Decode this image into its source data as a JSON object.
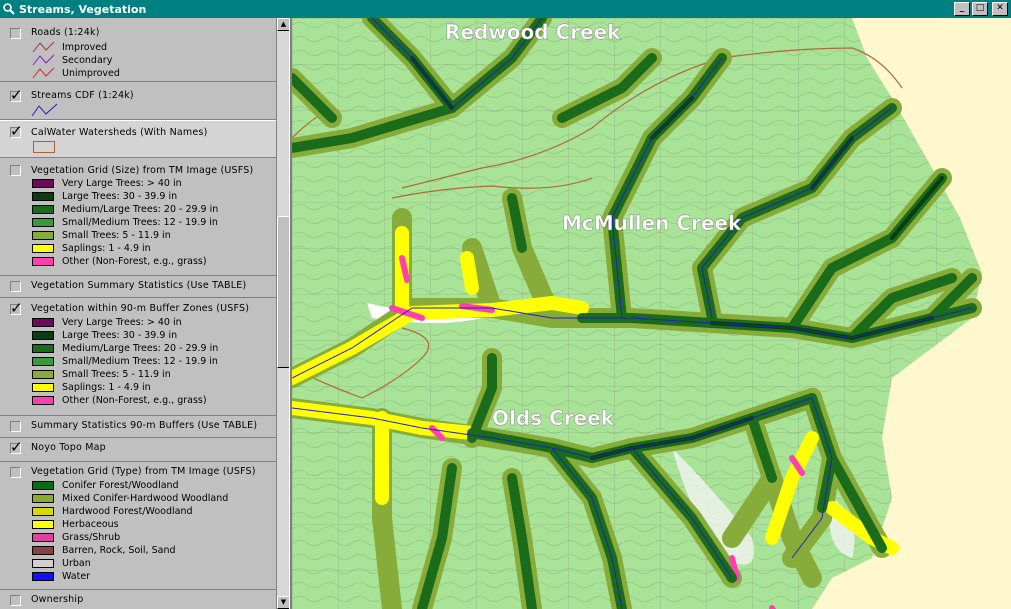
{
  "window": {
    "title": "Streams, Vegetation"
  },
  "colors": {
    "titlebar": "#008080",
    "panel": "#c0c0c0",
    "map_bg": "#fff8cf",
    "forest": "#a9e397"
  },
  "toc": {
    "roads": {
      "name": "Roads (1:24k)",
      "checked": false,
      "items": [
        {
          "label": "Improved",
          "color": "#b03030"
        },
        {
          "label": "Secondary",
          "color": "#8020c0"
        },
        {
          "label": "Unimproved",
          "color": "#e02020"
        }
      ]
    },
    "streams": {
      "name": "Streams CDF (1:24k)",
      "checked": true,
      "color": "#2020c0"
    },
    "watersheds": {
      "name": "CalWater Watersheds (With Names)",
      "checked": true,
      "color": "#b06030"
    },
    "veg_size": {
      "name": "Vegetation Grid (Size) from TM Image (USFS)",
      "checked": false,
      "items": [
        {
          "label": "Very Large Trees: > 40  in",
          "color": "#6b0a5a"
        },
        {
          "label": "Large Trees: 30 - 39.9 in",
          "color": "#0a3d12"
        },
        {
          "label": "Medium/Large Trees: 20 - 29.9 in",
          "color": "#1a6b1a"
        },
        {
          "label": "Small/Medium Trees: 12 - 19.9 in",
          "color": "#3a9a3a"
        },
        {
          "label": "Small Trees: 5 - 11.9 in",
          "color": "#88ac3a"
        },
        {
          "label": "Saplings: 1 - 4.9 in",
          "color": "#ffff00"
        },
        {
          "label": "Other (Non-Forest, e.g., grass)",
          "color": "#ff40b0"
        }
      ]
    },
    "veg_summary": {
      "name": "Vegetation Summary Statistics (Use TABLE)",
      "checked": false
    },
    "veg_buffer": {
      "name": "Vegetation within 90-m Buffer Zones (USFS)",
      "checked": true,
      "items": [
        {
          "label": "Very Large Trees: > 40  in",
          "color": "#6b0a5a"
        },
        {
          "label": "Large Trees: 30 - 39.9 in",
          "color": "#0a3d12"
        },
        {
          "label": "Medium/Large Trees: 20 - 29.9 in",
          "color": "#1a6b1a"
        },
        {
          "label": "Small/Medium Trees: 12 - 19.9 in",
          "color": "#3a9a3a"
        },
        {
          "label": "Small Trees: 5 - 11.9 in",
          "color": "#88ac3a"
        },
        {
          "label": "Saplings: 1 - 4.9 in",
          "color": "#ffff00"
        },
        {
          "label": "Other (Non-Forest, e.g., grass)",
          "color": "#ff40b0"
        }
      ]
    },
    "buffer_summary": {
      "name": "Summary Statistics 90-m Buffers (Use TABLE)",
      "checked": false
    },
    "topo": {
      "name": "Noyo Topo Map",
      "checked": true
    },
    "veg_type": {
      "name": "Vegetation Grid (Type) from TM Image (USFS)",
      "checked": false,
      "items": [
        {
          "label": "Conifer Forest/Woodland",
          "color": "#0a6b12"
        },
        {
          "label": "Mixed Conifer-Hardwood Woodland",
          "color": "#8aac2a"
        },
        {
          "label": "Hardwood Forest/Woodland",
          "color": "#d8d800"
        },
        {
          "label": "Herbaceous",
          "color": "#ffff00"
        },
        {
          "label": "Grass/Shrub",
          "color": "#e040a0"
        },
        {
          "label": "Barren, Rock, Soil, Sand",
          "color": "#8a4040"
        },
        {
          "label": "Urban",
          "color": "#d0d0d0"
        },
        {
          "label": "Water",
          "color": "#1010ff"
        }
      ]
    },
    "ownership": {
      "name": "Ownership",
      "checked": false
    }
  },
  "map": {
    "labels": [
      "Redwood Creek",
      "McMullen Creek",
      "Olds Creek"
    ]
  }
}
